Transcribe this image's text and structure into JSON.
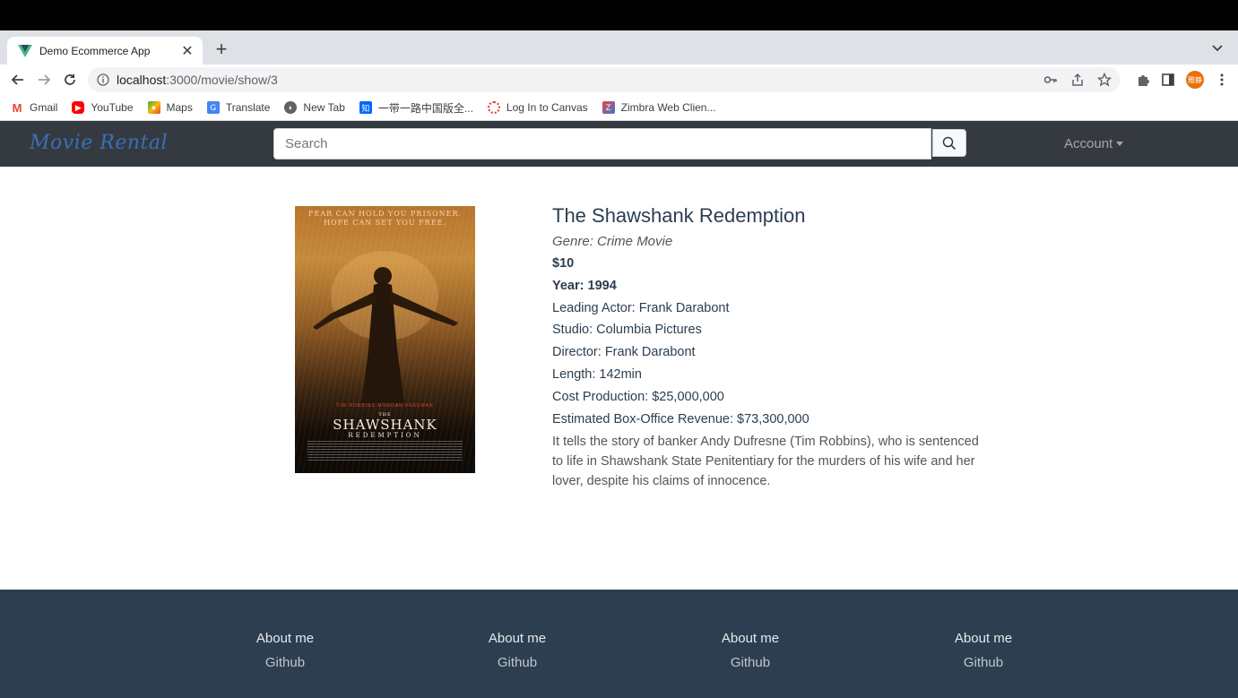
{
  "browser": {
    "tab_title": "Demo Ecommerce App",
    "url_host": "localhost",
    "url_path": ":3000/movie/show/3",
    "avatar_text": "雅静",
    "bookmarks": [
      {
        "label": "Gmail",
        "icon": "gmail-icon"
      },
      {
        "label": "YouTube",
        "icon": "youtube-icon"
      },
      {
        "label": "Maps",
        "icon": "maps-icon"
      },
      {
        "label": "Translate",
        "icon": "translate-icon"
      },
      {
        "label": "New Tab",
        "icon": "globe-icon"
      },
      {
        "label": "一带一路中国版全...",
        "icon": "zhihu-icon"
      },
      {
        "label": "Log In to Canvas",
        "icon": "canvas-icon"
      },
      {
        "label": "Zimbra Web Clien...",
        "icon": "zimbra-icon"
      }
    ]
  },
  "nav": {
    "brand": "Movie Rental",
    "search_placeholder": "Search",
    "account_label": "Account"
  },
  "poster": {
    "tagline_1": "FEAR CAN HOLD YOU PRISONER.",
    "tagline_2": "HOPE CAN SET YOU FREE.",
    "actors": "TIM ROBBINS    MORGAN FREEMAN",
    "title": "SHAWSHANK",
    "subtitle": "REDEMPTION",
    "the": "THE"
  },
  "movie": {
    "title": "The Shawshank Redemption",
    "genre": "Genre: Crime Movie",
    "price": "$10",
    "year": "Year: 1994",
    "leading_actor": "Leading Actor: Frank Darabont",
    "studio": "Studio: Columbia Pictures",
    "director": "Director: Frank Darabont",
    "length": "Length: 142min",
    "cost": "Cost Production: $25,000,000",
    "revenue": "Estimated Box-Office Revenue: $73,300,000",
    "description": "It tells the story of banker Andy Dufresne (Tim Robbins), who is sentenced to life in Shawshank State Penitentiary for the murders of his wife and her lover, despite his claims of innocence."
  },
  "footer": {
    "columns": [
      {
        "about": "About me",
        "link": "Github"
      },
      {
        "about": "About me",
        "link": "Github"
      },
      {
        "about": "About me",
        "link": "Github"
      },
      {
        "about": "About me",
        "link": "Github"
      }
    ]
  },
  "colors": {
    "navbar": "#343a40",
    "footer": "#2c3e50",
    "brand": "#3b6fb6"
  }
}
